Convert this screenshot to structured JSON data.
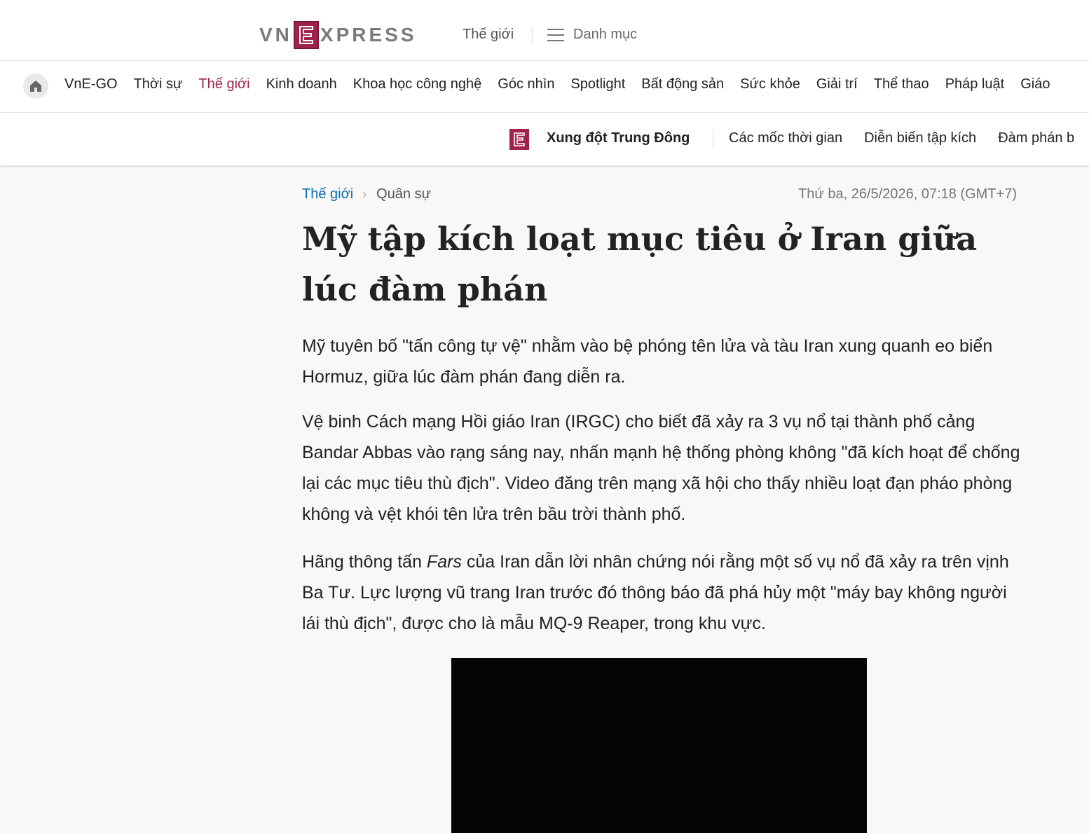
{
  "header": {
    "logo_left": "VN",
    "logo_right": "XPRESS",
    "section": "Thế giới",
    "menu_label": "Danh mục"
  },
  "nav": {
    "items": [
      {
        "label": "VnE-GO",
        "active": false
      },
      {
        "label": "Thời sự",
        "active": false
      },
      {
        "label": "Thế giới",
        "active": true
      },
      {
        "label": "Kinh doanh",
        "active": false
      },
      {
        "label": "Khoa học công nghệ",
        "active": false
      },
      {
        "label": "Góc nhìn",
        "active": false
      },
      {
        "label": "Spotlight",
        "active": false
      },
      {
        "label": "Bất động sản",
        "active": false
      },
      {
        "label": "Sức khỏe",
        "active": false
      },
      {
        "label": "Giải trí",
        "active": false
      },
      {
        "label": "Thể thao",
        "active": false
      },
      {
        "label": "Pháp luật",
        "active": false
      },
      {
        "label": "Giáo",
        "active": false
      }
    ],
    "active_color": "#9f224e"
  },
  "topic_bar": {
    "title": "Xung đột Trung Đông",
    "items": [
      "Các mốc thời gian",
      "Diễn biến tập kích",
      "Đàm phán b"
    ]
  },
  "breadcrumb": {
    "section": "Thế giới",
    "subsection": "Quân sự"
  },
  "date": "Thứ ba, 26/5/2026, 07:18 (GMT+7)",
  "article": {
    "title": "Mỹ tập kích loạt mục tiêu ở Iran giữa lúc đàm phán",
    "lead": "Mỹ tuyên bố \"tấn công tự vệ\" nhằm vào bệ phóng tên lửa và tàu Iran xung quanh eo biển Hormuz, giữa lúc đàm phán đang diễn ra.",
    "p1": "Vệ binh Cách mạng Hồi giáo Iran (IRGC) cho biết đã xảy ra 3 vụ nổ tại thành phố cảng Bandar Abbas vào rạng sáng nay, nhấn mạnh hệ thống phòng không \"đã kích hoạt để chống lại các mục tiêu thù địch\". Video đăng trên mạng xã hội cho thấy nhiều loạt đạn pháo phòng không và vệt khói tên lửa trên bầu trời thành phố.",
    "p2_before": "Hãng thông tấn ",
    "p2_em": "Fars",
    "p2_after": " của Iran dẫn lời nhân chứng nói rằng một số vụ nổ đã xảy ra trên vịnh Ba Tư. Lực lượng vũ trang Iran trước đó thông báo đã phá hủy một \"máy bay không người lái thù địch\", được cho là mẫu MQ-9 Reaper, trong khu vực."
  },
  "colors": {
    "brand": "#9f224e",
    "link": "#076db6",
    "background": "#f9f8f6"
  }
}
